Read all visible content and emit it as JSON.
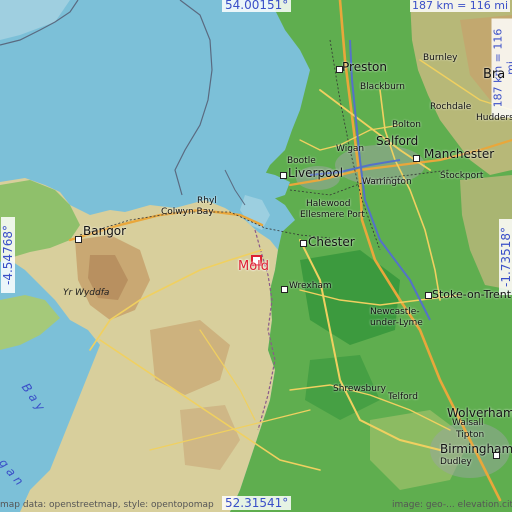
{
  "coords": {
    "top_lat": "54.00151°",
    "bottom_lat": "52.31541°",
    "left_lon": "-4.54768°",
    "right_lon": "-1.73518°"
  },
  "scale": {
    "top": "187 km = 116 mi",
    "right": "187 km = 116 mi"
  },
  "attribution": {
    "left": "map data: openstreetmap, style: opentopomap",
    "right": "image: geo-... elevation.city"
  },
  "marker": {
    "name": "Mold",
    "color": "#dd2233"
  },
  "sea_labels": {
    "bay_upper": "B a y",
    "bay_lower": "g a n"
  },
  "peak": {
    "name": "Yr Wyddfa"
  },
  "cities": [
    {
      "id": "preston",
      "name": "Preston"
    },
    {
      "id": "burnley",
      "name": "Burnley"
    },
    {
      "id": "blackburn",
      "name": "Blackburn"
    },
    {
      "id": "rochdale",
      "name": "Rochdale"
    },
    {
      "id": "bolton",
      "name": "Bolton"
    },
    {
      "id": "huddersfield",
      "name": "Hudders"
    },
    {
      "id": "bradford",
      "name": "Bra"
    },
    {
      "id": "wigan",
      "name": "Wigan"
    },
    {
      "id": "salford",
      "name": "Salford"
    },
    {
      "id": "manchester",
      "name": "Manchester"
    },
    {
      "id": "bootle",
      "name": "Bootle"
    },
    {
      "id": "liverpool",
      "name": "Liverpool"
    },
    {
      "id": "warrington",
      "name": "Warrington"
    },
    {
      "id": "stockport",
      "name": "Stockport"
    },
    {
      "id": "rhyl",
      "name": "Rhyl"
    },
    {
      "id": "colwyn-bay",
      "name": "Colwyn Bay"
    },
    {
      "id": "halewood",
      "name": "Halewood"
    },
    {
      "id": "ellesmere-port",
      "name": "Ellesmere Port"
    },
    {
      "id": "bangor",
      "name": "Bangor"
    },
    {
      "id": "chester",
      "name": "Chester"
    },
    {
      "id": "wrexham",
      "name": "Wrexham"
    },
    {
      "id": "stoke",
      "name": "Stoke-on-Trent"
    },
    {
      "id": "newcastle-1",
      "name": "Newcastle-"
    },
    {
      "id": "newcastle-2",
      "name": "under-Lyme"
    },
    {
      "id": "shrewsbury",
      "name": "Shrewsbury"
    },
    {
      "id": "telford",
      "name": "Telford"
    },
    {
      "id": "wolverhampton",
      "name": "Wolverham"
    },
    {
      "id": "walsall",
      "name": "Walsall"
    },
    {
      "id": "tipton",
      "name": "Tipton"
    },
    {
      "id": "birmingham",
      "name": "Birmingham"
    },
    {
      "id": "dudley",
      "name": "Dudley"
    }
  ]
}
